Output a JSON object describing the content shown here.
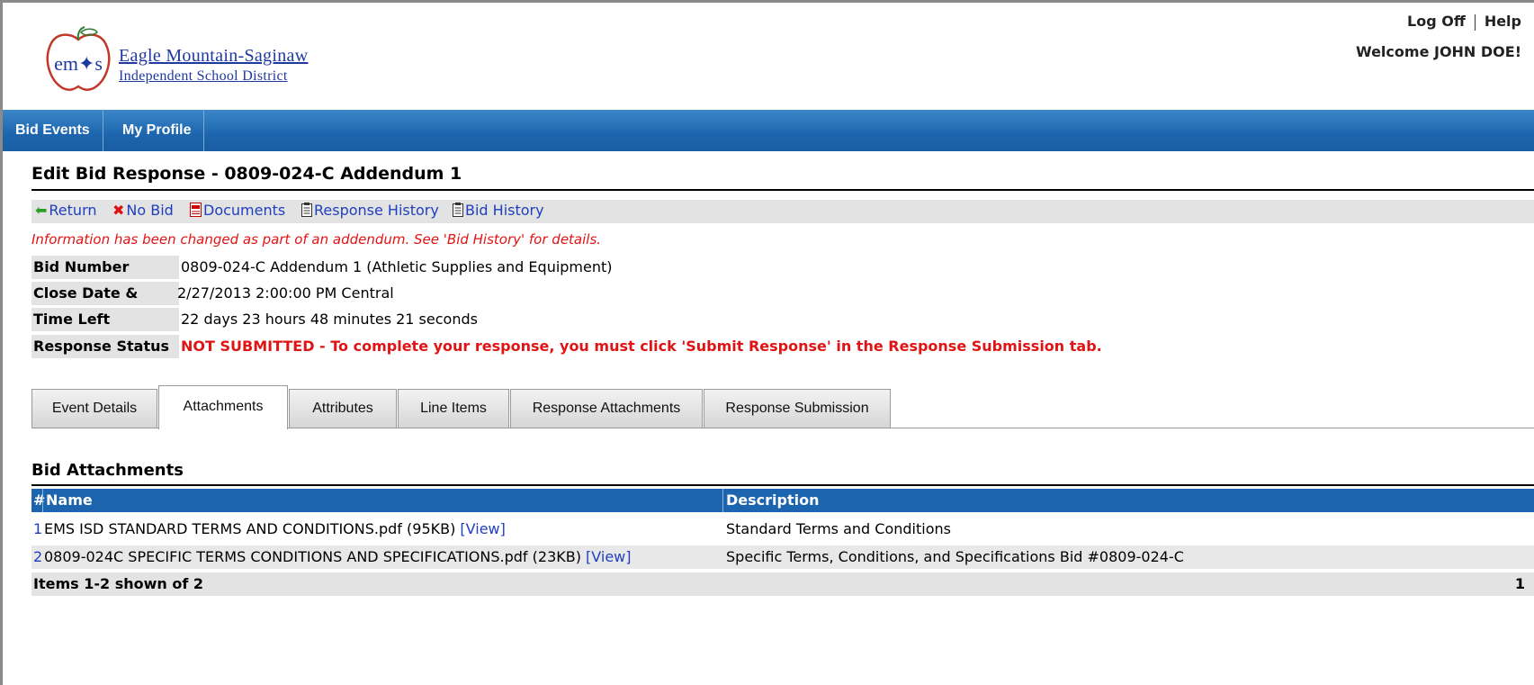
{
  "header": {
    "logo_line1": "Eagle Mountain-Saginaw",
    "logo_line2": "Independent School District",
    "logo_mark_text": "em✦s",
    "log_off": "Log Off",
    "help": "Help",
    "welcome": "Welcome JOHN DOE!"
  },
  "nav": {
    "items": [
      {
        "label": "Bid Events"
      },
      {
        "label": "My Profile"
      }
    ]
  },
  "page": {
    "title": "Edit Bid Response - 0809-024-C Addendum 1",
    "actions": [
      {
        "label": "Return",
        "icon": "green-arrow-left"
      },
      {
        "label": "No Bid",
        "icon": "red-x"
      },
      {
        "label": "Documents",
        "icon": "pdf-document"
      },
      {
        "label": "Response History",
        "icon": "clipboard"
      },
      {
        "label": "Bid History",
        "icon": "clipboard"
      }
    ],
    "addendum_note": "Information has been changed as part of an addendum. See 'Bid History' for details."
  },
  "bid_info": {
    "bid_number_label": "Bid Number",
    "bid_number": "0809-024-C Addendum 1 (Athletic Supplies and Equipment)",
    "close_label": "Close Date & Time",
    "close_value": "2/27/2013 2:00:00 PM Central",
    "time_left_label": "Time Left",
    "time_left": "22 days 23 hours 48 minutes 21 seconds",
    "status_label": "Response Status",
    "status_value": "NOT SUBMITTED - To complete your response, you must click 'Submit Response' in the Response Submission tab."
  },
  "tabs": [
    {
      "label": "Event Details",
      "active": false
    },
    {
      "label": "Attachments",
      "active": true
    },
    {
      "label": "Attributes",
      "active": false
    },
    {
      "label": "Line Items",
      "active": false
    },
    {
      "label": "Response Attachments",
      "active": false
    },
    {
      "label": "Response Submission",
      "active": false
    }
  ],
  "attachments": {
    "section_title": "Bid Attachments",
    "columns": {
      "num": "#",
      "name": "Name",
      "description": "Description"
    },
    "rows": [
      {
        "num": "1",
        "name": "EMS ISD STANDARD TERMS AND CONDITIONS.pdf (95KB) ",
        "view": "[View]",
        "description": "Standard Terms and Conditions"
      },
      {
        "num": "2",
        "name": "0809-024C SPECIFIC TERMS CONDITIONS AND SPECIFICATIONS.pdf (23KB) ",
        "view": "[View]",
        "description": "Specific Terms, Conditions, and Specifications Bid #0809-024-C"
      }
    ],
    "footer": "Items 1-2 shown of 2",
    "page": "1"
  },
  "colors": {
    "nav_blue": "#1d65ad",
    "link_blue": "#1f3fbf",
    "alert_red": "#e01414",
    "label_gray": "#e3e3e3"
  }
}
